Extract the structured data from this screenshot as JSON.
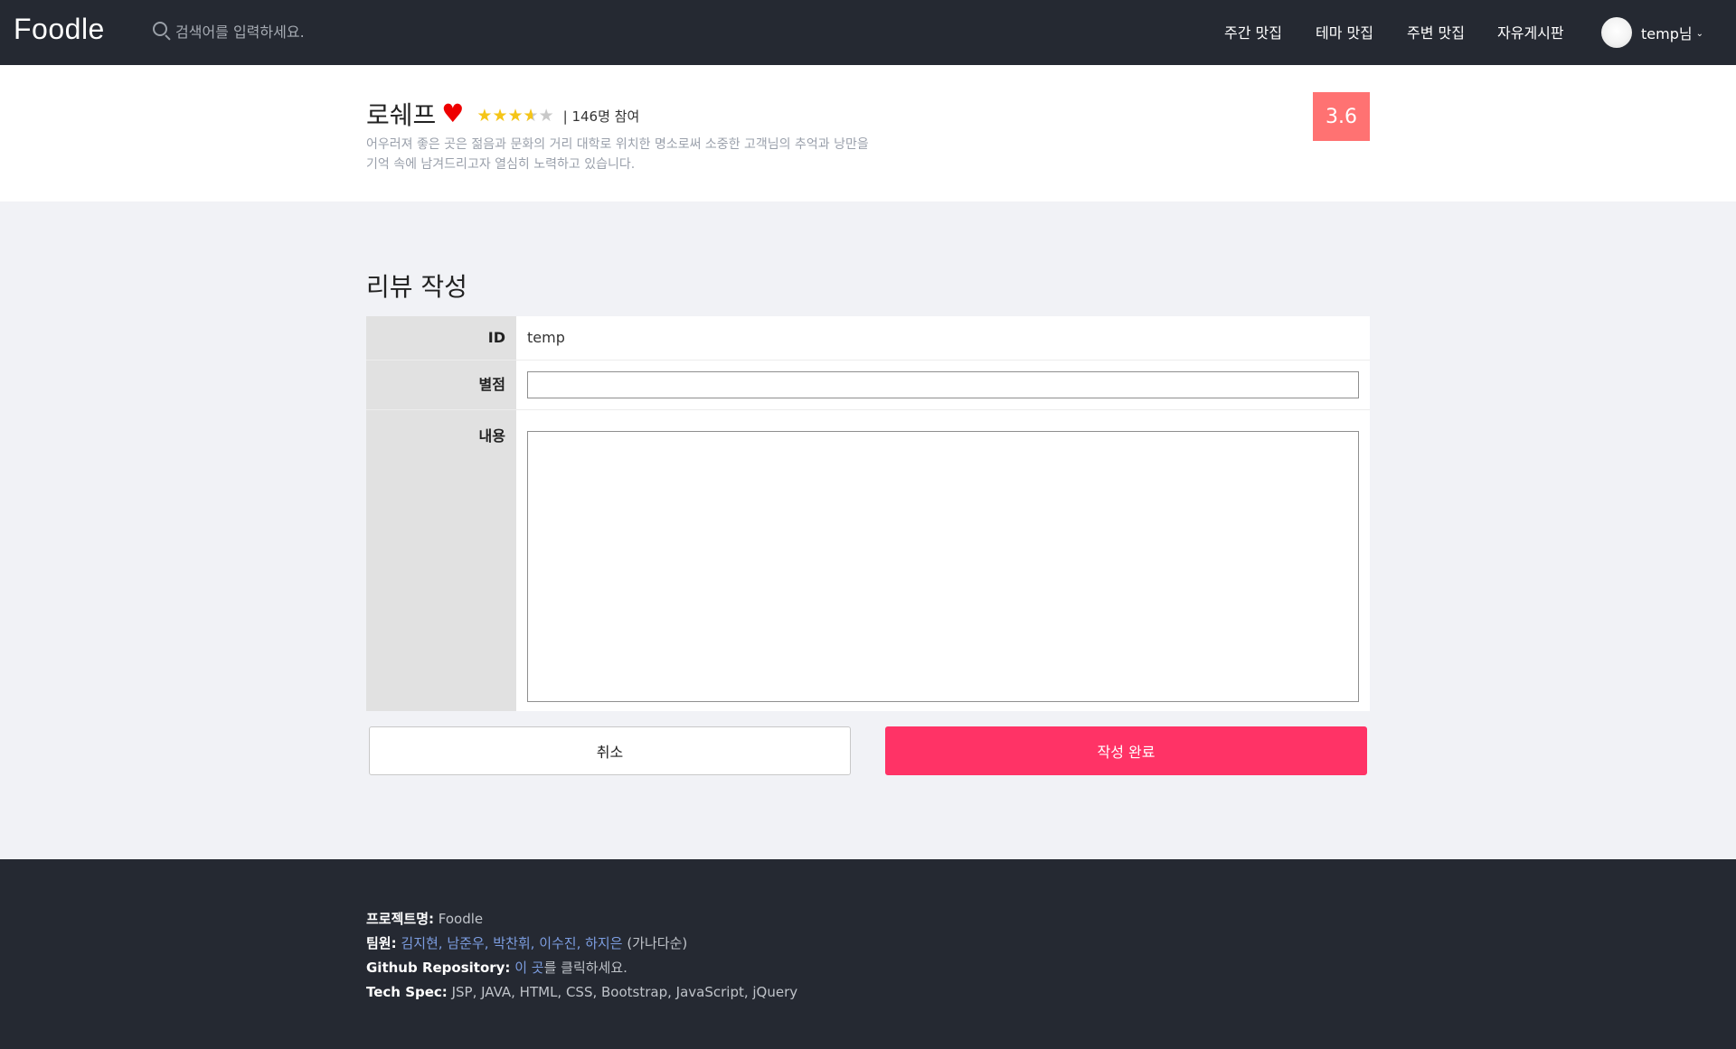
{
  "navbar": {
    "brand": "Foodle",
    "search_placeholder": "검색어를 입력하세요.",
    "menu": [
      "주간 맛집",
      "테마 맛집",
      "주변 맛집",
      "자유게시판"
    ],
    "user_label": "temp님",
    "user_chevron": "⌄"
  },
  "restaurant": {
    "name": "로쉐프",
    "heart_glyph": "♥",
    "star_glyph": "★",
    "rating_fraction_out_of_5": 3.6,
    "participation": "| 146명 참여",
    "description": "어우러져 좋은 곳은 젊음과 문화의 거리 대학로 위치한 명소로써 소중한 고객님의 추억과 낭만을 기억 속에 남겨드리고자 열심히 노력하고 있습니다.",
    "score": "3.6"
  },
  "review": {
    "title": "리뷰 작성",
    "id_label": "ID",
    "id_value": "temp",
    "star_label": "별점",
    "star_value": "",
    "content_label": "내용",
    "content_value": "",
    "cancel_label": "취소",
    "submit_label": "작성 완료"
  },
  "footer": {
    "project_key": "프로젝트명:",
    "project_value": "Foodle",
    "team_key": "팀원:",
    "team_members": "김지현, 남준우, 박찬휘, 이수진, 하지은",
    "team_suffix": "(가나다순)",
    "repo_key": "Github Repository:",
    "repo_link": "이 곳",
    "repo_suffix": "를 클릭하세요.",
    "tech_key": "Tech Spec:",
    "tech_value": "JSP, JAVA, HTML, CSS, Bootstrap, JavaScript, jQuery"
  },
  "colors": {
    "navbar_bg": "#252932",
    "page_bg": "#f1f2f6",
    "score_badge": "#ff7272",
    "submit_button": "#ff3366",
    "star": "#f5c518",
    "heart": "#ee0000",
    "footer_link": "#7c9de0"
  }
}
